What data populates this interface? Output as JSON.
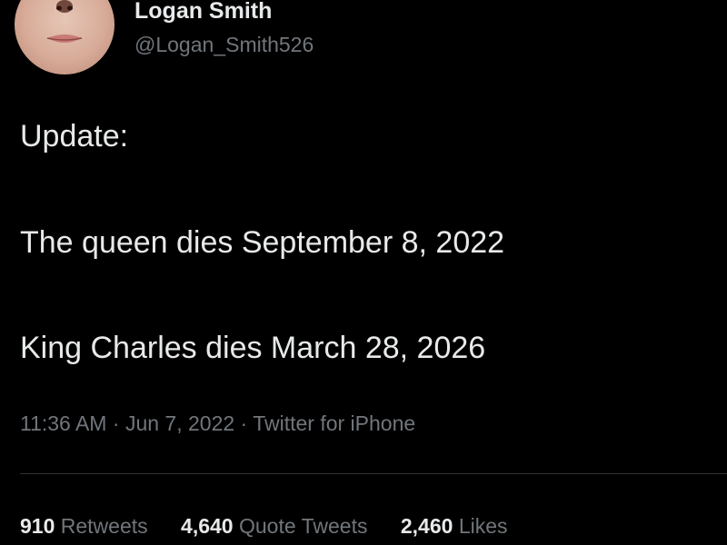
{
  "author": {
    "display_name": "Logan Smith",
    "handle": "@Logan_Smith526"
  },
  "tweet": {
    "lines": [
      "Update:",
      "The queen dies September 8, 2022",
      "King Charles dies March 28, 2026"
    ],
    "time": "11:36 AM",
    "date": "Jun 7, 2022",
    "source": "Twitter for iPhone",
    "separator": "·"
  },
  "stats": [
    {
      "count": "910",
      "label": "Retweets"
    },
    {
      "count": "4,640",
      "label": "Quote Tweets"
    },
    {
      "count": "2,460",
      "label": "Likes"
    }
  ],
  "colors": {
    "background": "#000000",
    "primary_text": "#e7e9ea",
    "secondary_text": "#71767b",
    "divider": "#2f3336"
  }
}
